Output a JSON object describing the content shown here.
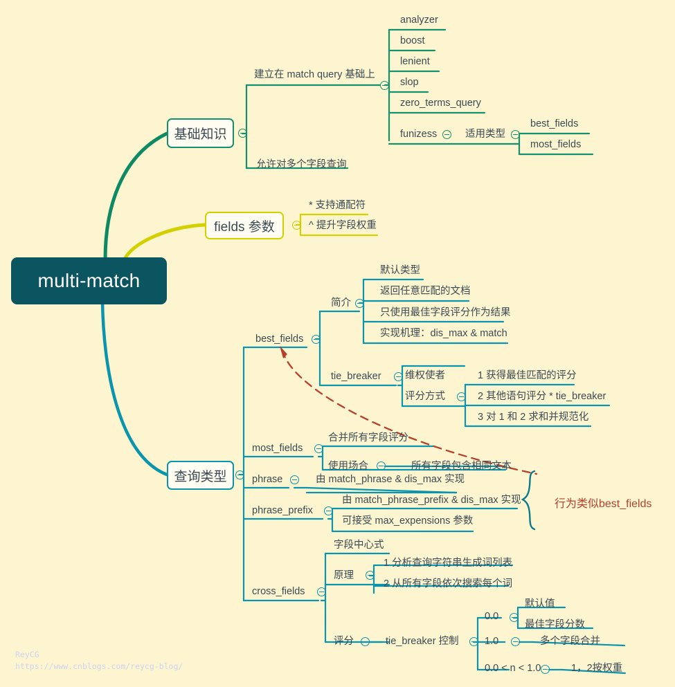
{
  "meta": {
    "background": "#fcf5d0",
    "text_color": "#3b4a54",
    "branch_colors": {
      "basic": "#14916c",
      "fields": "#d4d000",
      "query_type": "#0b94ad",
      "root": "#0b5560",
      "annotation": "#b5402c"
    }
  },
  "root": {
    "label": "multi-match"
  },
  "branches": {
    "basic": {
      "label": "基础知识",
      "children": [
        {
          "label": "建立在 match query 基础上",
          "toggle": true,
          "children": [
            {
              "label": "analyzer"
            },
            {
              "label": "boost"
            },
            {
              "label": "lenient"
            },
            {
              "label": "slop"
            },
            {
              "label": "zero_terms_query"
            },
            {
              "label": "funizess",
              "toggle": true,
              "children": [
                {
                  "label": "适用类型",
                  "toggle": true,
                  "children": [
                    {
                      "label": "best_fields"
                    },
                    {
                      "label": "most_fields"
                    }
                  ]
                }
              ]
            }
          ]
        },
        {
          "label": "允许对多个字段查询"
        }
      ]
    },
    "fields": {
      "label": "fields 参数",
      "toggle": true,
      "children": [
        {
          "label": "* 支持通配符"
        },
        {
          "label": "^ 提升字段权重"
        }
      ]
    },
    "query_type": {
      "label": "查询类型",
      "toggle": true,
      "children": [
        {
          "label": "best_fields",
          "toggle": true,
          "children": [
            {
              "label": "简介",
              "toggle": true,
              "children": [
                {
                  "label": "默认类型"
                },
                {
                  "label": "返回任意匹配的文档"
                },
                {
                  "label": "只使用最佳字段评分作为结果"
                },
                {
                  "label": "实现机理：dis_max & match"
                }
              ]
            },
            {
              "label": "tie_breaker",
              "toggle": true,
              "children": [
                {
                  "label": "维权使者"
                },
                {
                  "label": "评分方式",
                  "toggle": true,
                  "children": [
                    {
                      "label": "1 获得最佳匹配的评分"
                    },
                    {
                      "label": "2  其他语句评分 * tie_breaker"
                    },
                    {
                      "label": "3 对 1 和 2 求和并规范化"
                    }
                  ]
                }
              ]
            }
          ]
        },
        {
          "label": "most_fields",
          "toggle": true,
          "children": [
            {
              "label": "合并所有字段评分"
            },
            {
              "label": "使用场合",
              "toggle": true,
              "children": [
                {
                  "label": "所有字段包含相同文本"
                }
              ]
            }
          ]
        },
        {
          "label": "phrase",
          "toggle": true,
          "children": [
            {
              "label": "由 match_phrase & dis_max 实现"
            }
          ]
        },
        {
          "label": "phrase_prefix",
          "toggle": true,
          "children": [
            {
              "label": "由 match_phrase_prefix & dis_max 实现"
            },
            {
              "label": "可接受 max_expensions 参数"
            }
          ]
        },
        {
          "label": "cross_fields",
          "toggle": true,
          "children": [
            {
              "label": "字段中心式"
            },
            {
              "label": "原理",
              "toggle": true,
              "children": [
                {
                  "label": "1 分析查询字符串生成词列表"
                },
                {
                  "label": "2 从所有字段依次搜索每个词"
                }
              ]
            },
            {
              "label": "评分",
              "toggle": true,
              "children": [
                {
                  "label": "tie_breaker 控制",
                  "toggle": true,
                  "children": [
                    {
                      "label": "0.0",
                      "toggle": true,
                      "children": [
                        {
                          "label": "默认值"
                        },
                        {
                          "label": "最佳字段分数"
                        }
                      ]
                    },
                    {
                      "label": "1.0",
                      "toggle": true,
                      "children": [
                        {
                          "label": "多个字段合并"
                        }
                      ]
                    },
                    {
                      "label": "0.0 < n < 1.0",
                      "toggle": true,
                      "children": [
                        {
                          "label": "1，2按权重"
                        }
                      ]
                    }
                  ]
                }
              ]
            }
          ]
        }
      ]
    }
  },
  "annotation": {
    "label": "行为类似best_fields"
  },
  "watermark": {
    "line1": "ReyCG",
    "line2": "https://www.cnblogs.com/reycg-blog/"
  },
  "labels": {
    "analyzer": "analyzer",
    "boost": "boost",
    "lenient": "lenient",
    "slop": "slop",
    "zero_terms_query": "zero_terms_query",
    "funizess": "funizess",
    "applicable_types": "适用类型",
    "bf_top": "best_fields",
    "mf_top": "most_fields",
    "built_on_match": "建立在 match query 基础上",
    "multi_field_query": "允许对多个字段查询",
    "wildcard": "* 支持通配符",
    "boost_weight": "^ 提升字段权重",
    "best_fields": "best_fields",
    "intro": "简介",
    "default_type": "默认类型",
    "return_any": "返回任意匹配的文档",
    "only_best": "只使用最佳字段评分作为结果",
    "mechanism": "实现机理：dis_max & match",
    "tie_breaker": "tie_breaker",
    "defender": "维权使者",
    "scoring_way": "评分方式",
    "score1": "1 获得最佳匹配的评分",
    "score2": "2  其他语句评分 * tie_breaker",
    "score3": "3 对 1 和 2 求和并规范化",
    "most_fields": "most_fields",
    "merge_all": "合并所有字段评分",
    "use_case": "使用场合",
    "same_text": "所有字段包含相同文本",
    "phrase": "phrase",
    "phrase_impl": "由 match_phrase & dis_max 实现",
    "phrase_prefix": "phrase_prefix",
    "pp_impl": "由 match_phrase_prefix & dis_max 实现",
    "pp_param": "可接受 max_expensions 参数",
    "cross_fields": "cross_fields",
    "field_centric": "字段中心式",
    "principle": "原理",
    "p1": "1 分析查询字符串生成词列表",
    "p2": "2 从所有字段依次搜索每个词",
    "score": "评分",
    "tb_control": "tie_breaker 控制",
    "v00": "0.0",
    "v00_default": "默认值",
    "v00_best": "最佳字段分数",
    "v10": "1.0",
    "v10_merge": "多个字段合并",
    "vn": "0.0 < n < 1.0",
    "vn_weight": "1，2按权重"
  }
}
